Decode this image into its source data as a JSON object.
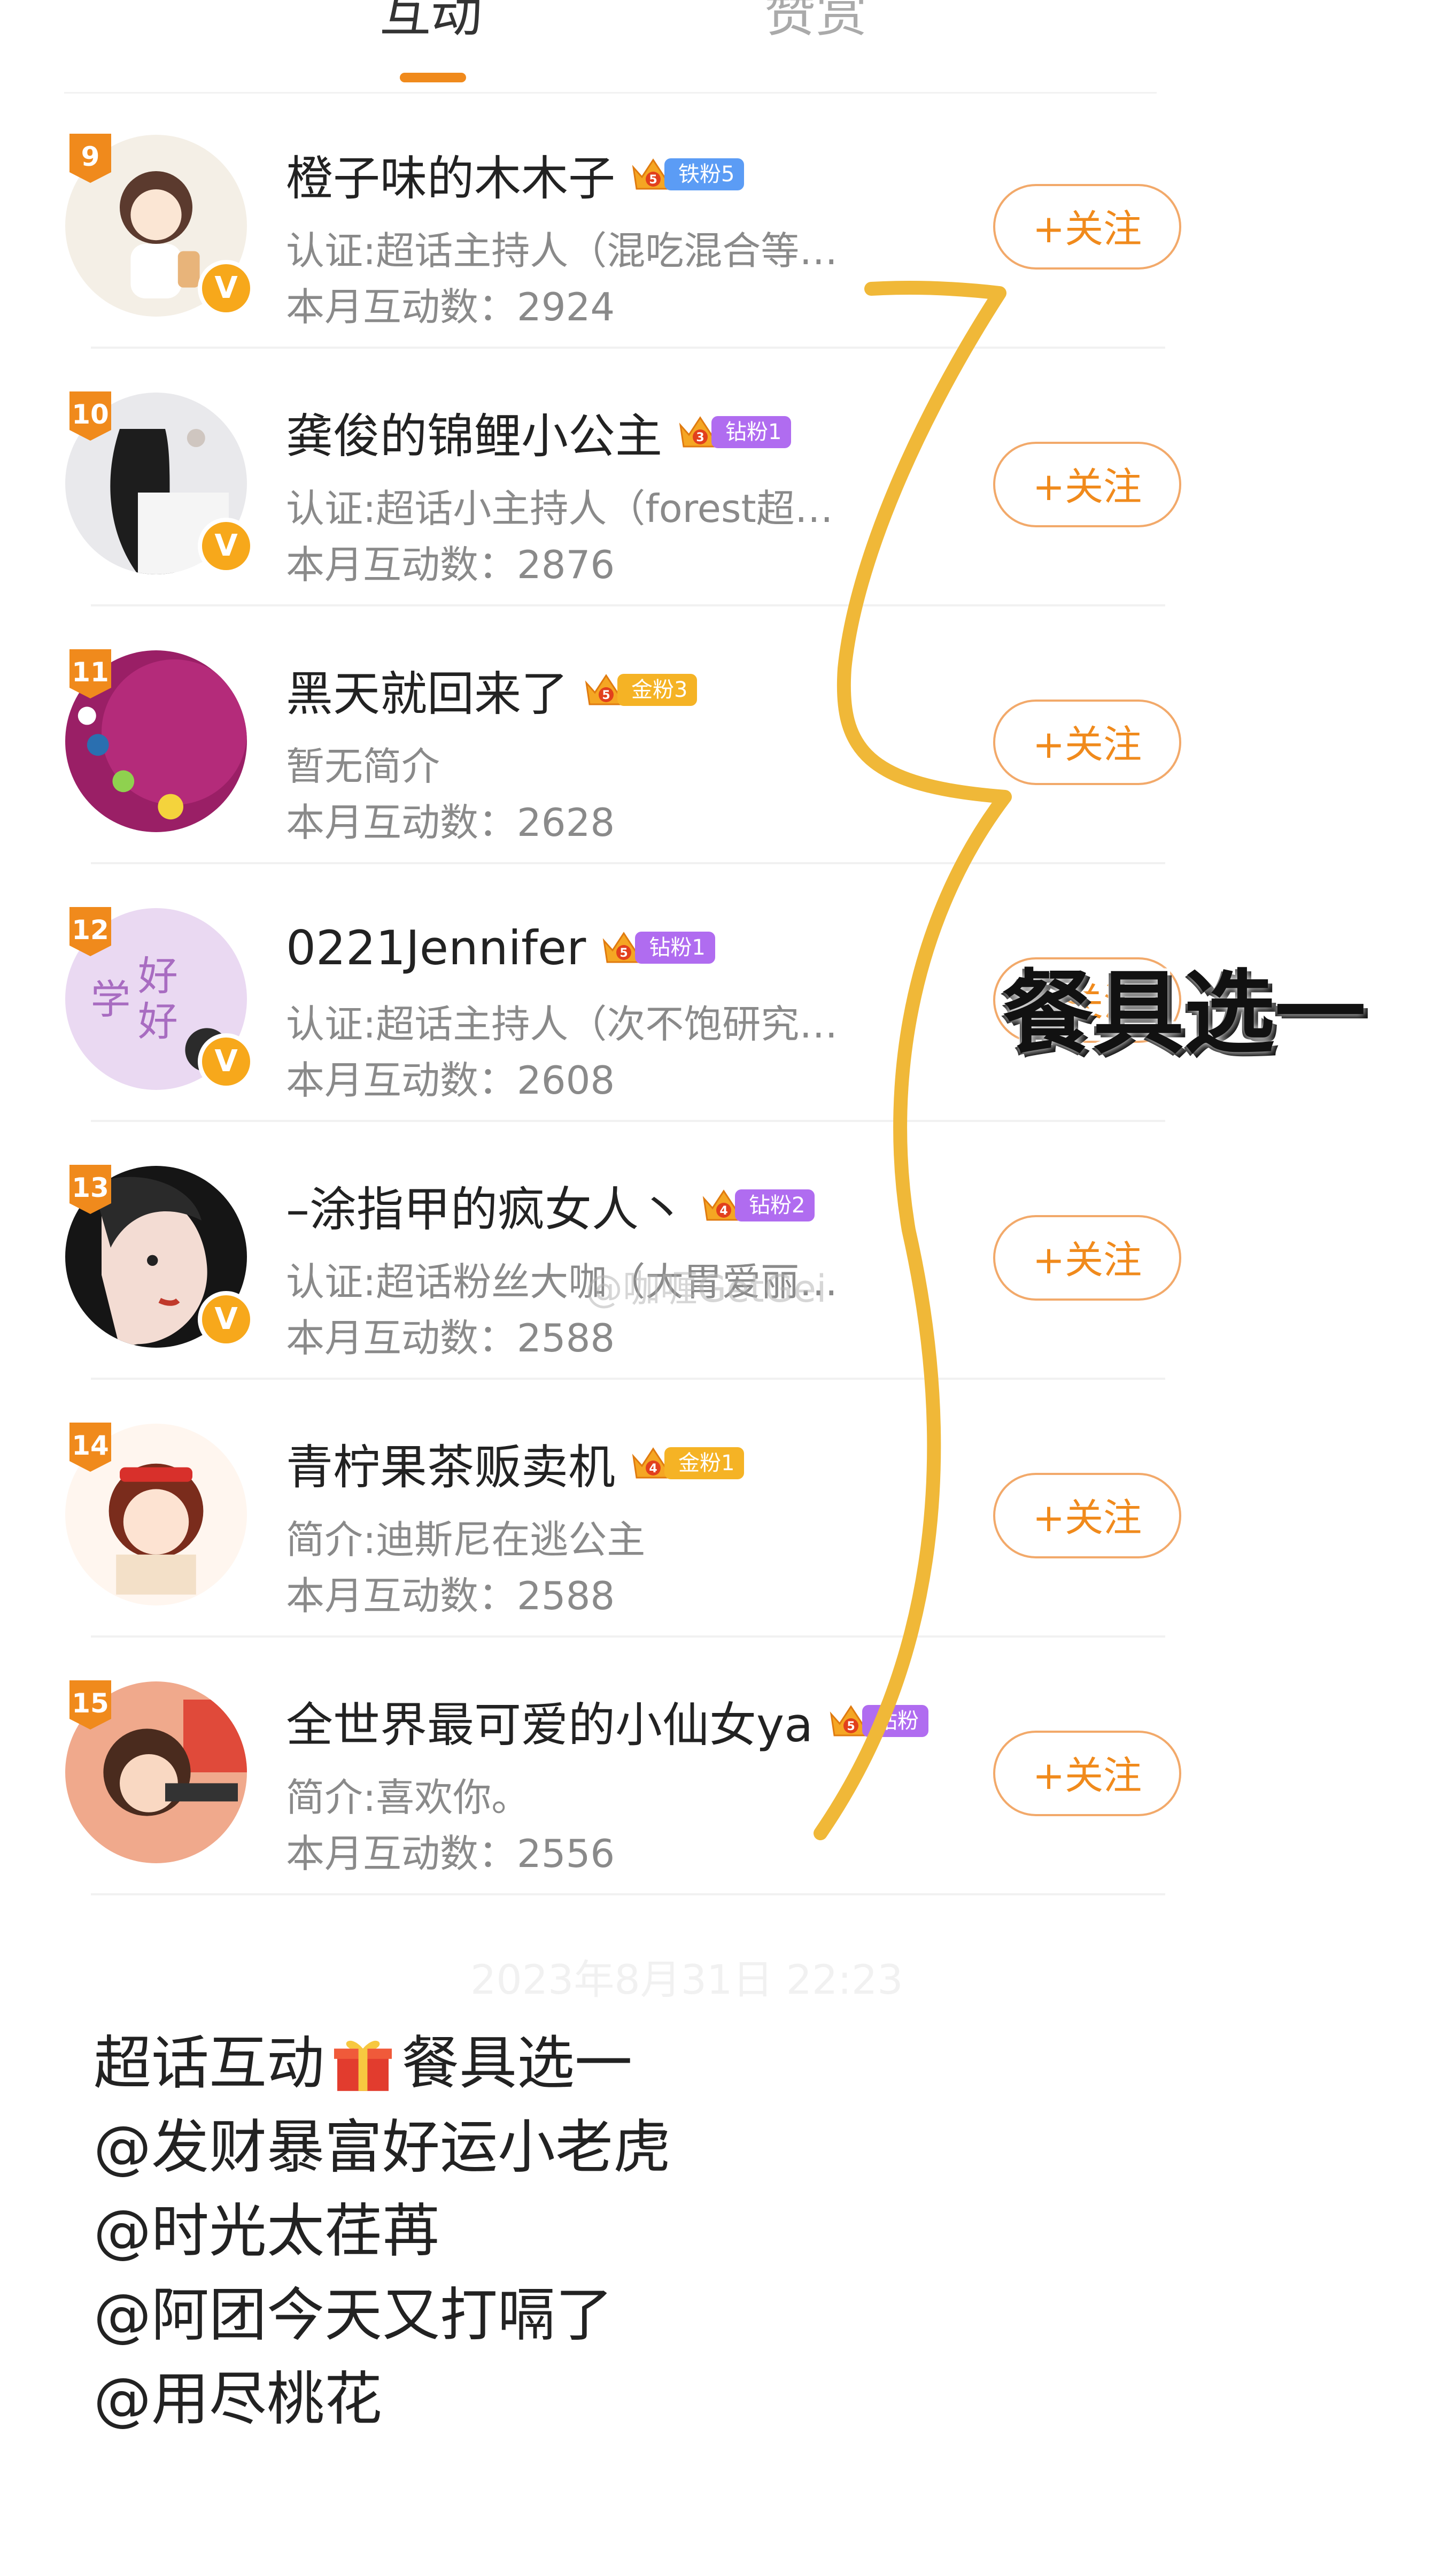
{
  "tabs": [
    {
      "label": "互动",
      "active": true
    },
    {
      "label": "赞赏",
      "active": false
    }
  ],
  "rows": [
    {
      "rank": "9",
      "name": "橙子味的木木子",
      "badge": "铁粉5",
      "badge_level": "5",
      "badge_color": "#5b9cf5",
      "desc": "认证:超话主持人（混吃混合等…",
      "count": "本月互动数：2924",
      "follow": "+关注",
      "verified": true
    },
    {
      "rank": "10",
      "name": "龚俊的锦鲤小公主",
      "badge": "钻粉1",
      "badge_level": "3",
      "badge_color": "#b06cf0",
      "desc": "认证:超话小主持人（forest超…",
      "count": "本月互动数：2876",
      "follow": "+关注",
      "verified": true
    },
    {
      "rank": "11",
      "name": "黑天就回来了",
      "badge": "金粉3",
      "badge_level": "5",
      "badge_color": "#f5b325",
      "desc": "暂无简介",
      "count": "本月互动数：2628",
      "follow": "+关注",
      "verified": false
    },
    {
      "rank": "12",
      "name": "0221Jennifer",
      "badge": "钻粉1",
      "badge_level": "5",
      "badge_color": "#b06cf0",
      "desc": "认证:超话主持人（次不饱研究…",
      "count": "本月互动数：2608",
      "follow": "+关注",
      "verified": true
    },
    {
      "rank": "13",
      "name": "–涂指甲的疯女人丶",
      "badge": "钻粉2",
      "badge_level": "4",
      "badge_color": "#b06cf0",
      "desc": "认证:超话粉丝大咖（大胃爱丽…",
      "count": "本月互动数：2588",
      "follow": "+关注",
      "verified": true
    },
    {
      "rank": "14",
      "name": "青柠果茶贩卖机",
      "badge": "金粉1",
      "badge_level": "4",
      "badge_color": "#f5b325",
      "desc": "简介:迪斯尼在逃公主",
      "count": "本月互动数：2588",
      "follow": "+关注",
      "verified": false
    },
    {
      "rank": "15",
      "name": "全世界最可爱的小仙女ya",
      "badge": "钻粉",
      "badge_level": "5",
      "badge_color": "#b06cf0",
      "desc": "简介:喜欢你。",
      "count": "本月互动数：2556",
      "follow": "+关注",
      "verified": false
    }
  ],
  "annotation": {
    "text": "餐具选一",
    "stroke_color": "#f0b838"
  },
  "watermark": "@咖喱GetGei",
  "post_time": "2023年8月31日 22:23",
  "post": {
    "line1_prefix": "超话互动",
    "line1_suffix": "餐具选一",
    "mentions": [
      "@发财暴富好运小老虎",
      "@时光太荏苒",
      "@阿团今天又打嗝了",
      "@用尽桃花"
    ]
  },
  "colors": {
    "accent": "#f08a1c",
    "verified": "#f7a81b"
  }
}
